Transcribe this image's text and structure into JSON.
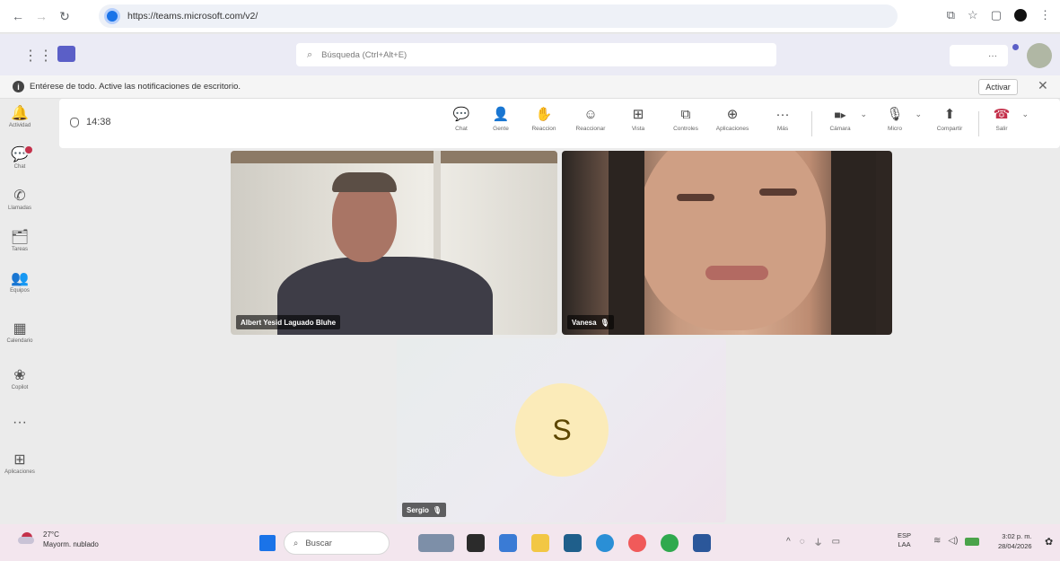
{
  "browser": {
    "url": "https://teams.microsoft.com/v2/"
  },
  "teams_header": {
    "search_placeholder": "Búsqueda (Ctrl+Alt+E)",
    "more_label": "···"
  },
  "notification_bar": {
    "message": "Entérese de todo. Active las notificaciones de escritorio.",
    "action_label": "Activar",
    "close_glyph": "✕"
  },
  "rail": {
    "items": [
      {
        "label": "Actividad",
        "icon": "bell-icon",
        "glyph": "🔔"
      },
      {
        "label": "Chat",
        "icon": "chat-icon",
        "glyph": "💬"
      },
      {
        "label": "Llamadas",
        "icon": "phone-icon",
        "glyph": "✆"
      },
      {
        "label": "Tareas",
        "icon": "tasks-icon",
        "glyph": "🗂"
      },
      {
        "label": "Equipos",
        "icon": "teams-icon",
        "glyph": "👥"
      },
      {
        "label": "Calendario",
        "icon": "calendar-icon",
        "glyph": "▦"
      },
      {
        "label": "Copilot",
        "icon": "copilot-icon",
        "glyph": "❀"
      },
      {
        "label": "",
        "icon": "more-icon",
        "glyph": "···"
      },
      {
        "label": "Aplicaciones",
        "icon": "apps-icon",
        "glyph": "⊞"
      }
    ]
  },
  "meeting": {
    "timer": "14:38",
    "tools": [
      {
        "label": "Chat",
        "icon": "chat-icon",
        "glyph": "💬"
      },
      {
        "label": "Gente",
        "icon": "people-icon",
        "glyph": "👤"
      },
      {
        "label": "Reaccion",
        "icon": "raise-hand-icon",
        "glyph": "✋"
      },
      {
        "label": "Reaccionar",
        "icon": "emoji-icon",
        "glyph": "☺"
      },
      {
        "label": "Vista",
        "icon": "grid-view-icon",
        "glyph": "⊞"
      },
      {
        "label": "Controles",
        "icon": "controls-icon",
        "glyph": "⧉"
      },
      {
        "label": "Aplicaciones",
        "icon": "apps-icon",
        "glyph": "⊕"
      },
      {
        "label": "Más",
        "icon": "more-icon",
        "glyph": "···"
      }
    ],
    "av_controls": [
      {
        "label": "Cámara",
        "icon": "camera-icon",
        "glyph": "■▸"
      },
      {
        "label": "Micro",
        "icon": "microphone-icon",
        "glyph": "🎙"
      },
      {
        "label": "Compartir",
        "icon": "share-icon",
        "glyph": "⬆"
      },
      {
        "label": "Salir",
        "icon": "hang-up-icon",
        "glyph": "☎"
      }
    ],
    "caret": "⌄"
  },
  "participants": [
    {
      "name": "Albert Yesid Laguado Bluhe"
    },
    {
      "name": "Vanesa"
    },
    {
      "name": "Sergio",
      "initial": "S"
    }
  ],
  "taskbar": {
    "temperature": "27°C",
    "weather": "Mayorm. nublado",
    "search_placeholder": "Buscar",
    "lang_top": "ESP",
    "lang_bottom": "LAA",
    "time": "3:02 p. m.",
    "date": "28/04/2026"
  }
}
